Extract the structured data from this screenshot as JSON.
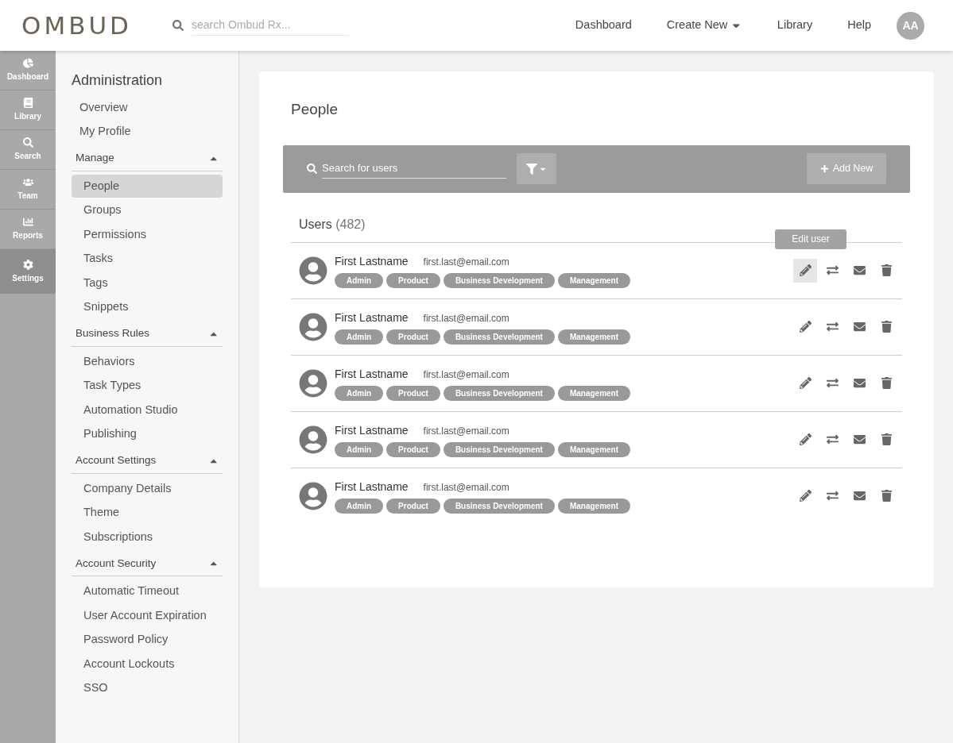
{
  "header": {
    "logo": "OMBUD",
    "search": {
      "placeholder": "search Ombud Rx..."
    },
    "nav": [
      {
        "label": "Dashboard",
        "dropdown": false
      },
      {
        "label": "Create New",
        "dropdown": true
      },
      {
        "label": "Library",
        "dropdown": false
      },
      {
        "label": "Help",
        "dropdown": false
      }
    ],
    "avatar": "AA"
  },
  "rail": [
    {
      "label": "Dashboard",
      "selected": false
    },
    {
      "label": "Library",
      "selected": false
    },
    {
      "label": "Search",
      "selected": false
    },
    {
      "label": "Team",
      "selected": false
    },
    {
      "label": "Reports",
      "selected": false
    },
    {
      "label": "Settings",
      "selected": true
    }
  ],
  "sidebar": {
    "title": "Administration",
    "top_items": [
      {
        "label": "Overview",
        "selected": false
      },
      {
        "label": "My Profile",
        "selected": false
      }
    ],
    "sections": [
      {
        "heading": "Manage",
        "expanded": true,
        "items": [
          {
            "label": "People",
            "selected": true
          },
          {
            "label": "Groups",
            "selected": false
          },
          {
            "label": "Permissions",
            "selected": false
          },
          {
            "label": "Tasks",
            "selected": false
          },
          {
            "label": "Tags",
            "selected": false
          },
          {
            "label": "Snippets",
            "selected": false
          }
        ]
      },
      {
        "heading": "Business Rules",
        "expanded": true,
        "items": [
          {
            "label": "Behaviors",
            "selected": false
          },
          {
            "label": "Task Types",
            "selected": false
          },
          {
            "label": "Automation Studio",
            "selected": false
          },
          {
            "label": "Publishing",
            "selected": false
          }
        ]
      },
      {
        "heading": "Account Settings",
        "expanded": true,
        "items": [
          {
            "label": "Company Details",
            "selected": false
          },
          {
            "label": "Theme",
            "selected": false
          },
          {
            "label": "Subscriptions",
            "selected": false
          }
        ]
      },
      {
        "heading": "Account Security",
        "expanded": true,
        "items": [
          {
            "label": "Automatic Timeout",
            "selected": false
          },
          {
            "label": "User Account Expiration",
            "selected": false
          },
          {
            "label": "Password Policy",
            "selected": false
          },
          {
            "label": "Account Lockouts",
            "selected": false
          },
          {
            "label": "SSO",
            "selected": false
          }
        ]
      }
    ]
  },
  "main": {
    "title": "People",
    "toolbar": {
      "search": {
        "placeholder": "Search for users"
      },
      "add_button": "Add New"
    },
    "users_heading": "Users",
    "users_count": "(482)",
    "edit_tooltip": "Edit user",
    "users": [
      {
        "name": "First Lastname",
        "email": "first.last@email.com",
        "tags": [
          "Admin",
          "Product",
          "Business Development",
          "Management"
        ],
        "hovered": true
      },
      {
        "name": "First Lastname",
        "email": "first.last@email.com",
        "tags": [
          "Admin",
          "Product",
          "Business Development",
          "Management"
        ],
        "hovered": false
      },
      {
        "name": "First Lastname",
        "email": "first.last@email.com",
        "tags": [
          "Admin",
          "Product",
          "Business Development",
          "Management"
        ],
        "hovered": false
      },
      {
        "name": "First Lastname",
        "email": "first.last@email.com",
        "tags": [
          "Admin",
          "Product",
          "Business Development",
          "Management"
        ],
        "hovered": false
      },
      {
        "name": "First Lastname",
        "email": "first.last@email.com",
        "tags": [
          "Admin",
          "Product",
          "Business Development",
          "Management"
        ],
        "hovered": false
      }
    ]
  }
}
